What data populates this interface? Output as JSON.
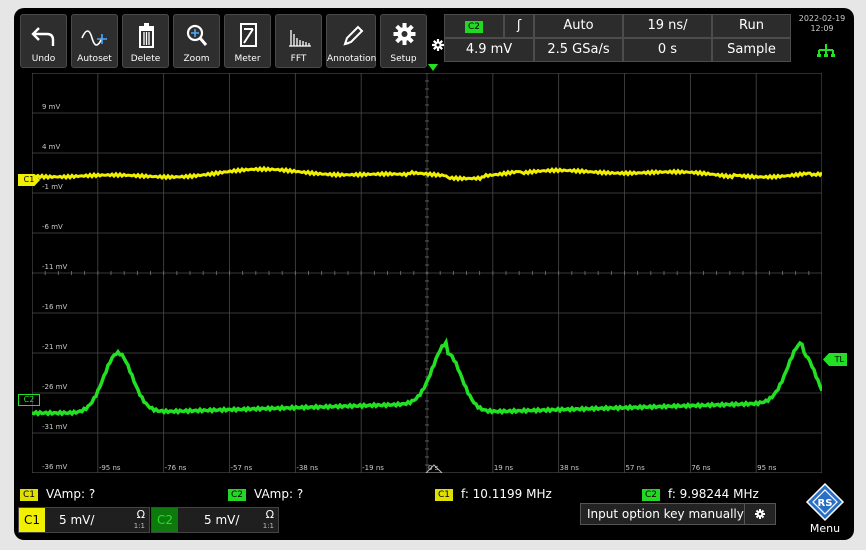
{
  "toolbar": {
    "buttons": [
      {
        "label": "Undo",
        "icon": "undo-icon"
      },
      {
        "label": "Autoset",
        "icon": "autoset-icon"
      },
      {
        "label": "Delete",
        "icon": "trash-icon"
      },
      {
        "label": "Zoom",
        "icon": "zoom-icon"
      },
      {
        "label": "Meter",
        "icon": "meter-icon"
      },
      {
        "label": "FFT",
        "icon": "fft-icon"
      },
      {
        "label": "Annotation",
        "icon": "pencil-icon"
      },
      {
        "label": "Setup",
        "icon": "gear-icon"
      }
    ]
  },
  "status": {
    "trigger_channel": "C2",
    "trigger_slope": "ʃ",
    "trigger_mode": "Auto",
    "timebase": "19 ns/",
    "acq_state": "Run",
    "trigger_level": "4.9 mV",
    "sample_rate": "2.5 GSa/s",
    "trigger_offset": "0 s",
    "acq_mode": "Sample",
    "date": "2022-02-19",
    "time": "12:09"
  },
  "grid": {
    "y_labels": [
      "9 mV",
      "4 mV",
      "-1 mV",
      "-6 mV",
      "-11 mV",
      "-16 mV",
      "-21 mV",
      "-26 mV",
      "-31 mV",
      "-36 mV"
    ],
    "x_labels": [
      "-95 ns",
      "-76 ns",
      "-57 ns",
      "-38 ns",
      "-19 ns",
      "0 s",
      "19 ns",
      "38 ns",
      "57 ns",
      "76 ns",
      "95 ns"
    ],
    "c1_marker": "C1",
    "c2_marker": "C2",
    "trigger_marker": "TL",
    "trigger_pos_marker": "T"
  },
  "colors": {
    "c1": "#f0f000",
    "c2": "#22e022",
    "grid": "#555555",
    "background": "#000000"
  },
  "measurements": [
    {
      "channel": "C1",
      "text": "VAmp: ?"
    },
    {
      "channel": "C2",
      "text": "VAmp: ?"
    },
    {
      "channel": "C1",
      "text": "f: 10.1199 MHz"
    },
    {
      "channel": "C2",
      "text": "f: 9.98244 MHz"
    }
  ],
  "channels": [
    {
      "name": "C1",
      "scale": "5 mV/",
      "coupling": "Ω",
      "ratio": "1:1"
    },
    {
      "name": "C2",
      "scale": "5 mV/",
      "coupling": "Ω",
      "ratio": "1:1"
    }
  ],
  "option_bar": {
    "text": "Input option key manually"
  },
  "menu": {
    "label": "Menu"
  }
}
